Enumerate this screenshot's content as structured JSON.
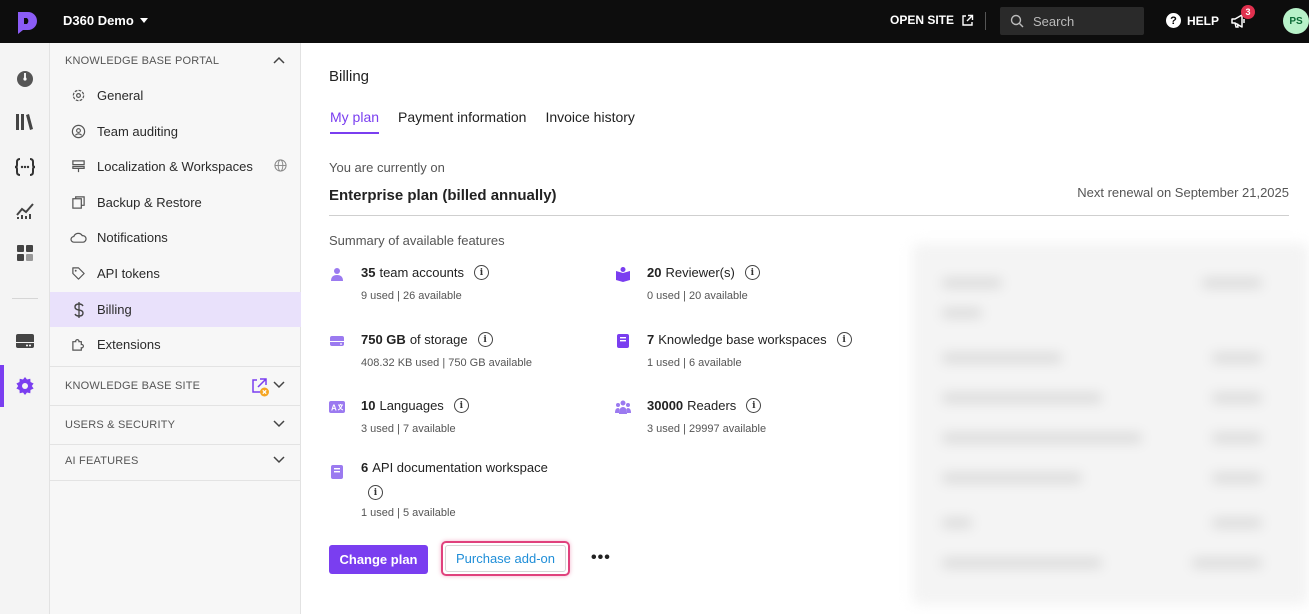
{
  "topbar": {
    "project_name": "D360 Demo",
    "open_site_label": "OPEN SITE",
    "search_placeholder": "Search",
    "help_label": "HELP",
    "notification_count": "3",
    "avatar_initials": "PS"
  },
  "sidenav": {
    "kb_portal": {
      "header": "KNOWLEDGE BASE PORTAL",
      "items": [
        {
          "label": "General",
          "icon": "gear-icon"
        },
        {
          "label": "Team auditing",
          "icon": "audit-icon"
        },
        {
          "label": "Localization & Workspaces",
          "icon": "workspaces-icon"
        },
        {
          "label": "Backup & Restore",
          "icon": "backup-icon"
        },
        {
          "label": "Notifications",
          "icon": "cloud-bell-icon"
        },
        {
          "label": "API tokens",
          "icon": "tag-icon"
        },
        {
          "label": "Billing",
          "icon": "dollar-icon"
        },
        {
          "label": "Extensions",
          "icon": "puzzle-icon"
        }
      ]
    },
    "kb_site_header": "KNOWLEDGE BASE SITE",
    "users_security_header": "USERS & SECURITY",
    "ai_features_header": "AI FEATURES"
  },
  "main": {
    "page_title": "Billing",
    "tabs": [
      {
        "label": "My plan",
        "active": true
      },
      {
        "label": "Payment information",
        "active": false
      },
      {
        "label": "Invoice history",
        "active": false
      }
    ],
    "current_on_label": "You are currently on",
    "plan_name": "Enterprise plan (billed annually)",
    "renewal_text": "Next renewal on September 21,2025",
    "summary_label": "Summary of available features",
    "features": [
      {
        "count": "35",
        "name": "team accounts",
        "usage": "9 used | 26 available",
        "icon": "user-icon"
      },
      {
        "count": "20",
        "name": "Reviewer(s)",
        "usage": "0 used | 20 available",
        "icon": "reviewer-icon"
      },
      {
        "count": "750 GB",
        "name": "of storage",
        "usage": "408.32 KB used | 750 GB available",
        "icon": "storage-icon"
      },
      {
        "count": "7",
        "name": "Knowledge base workspaces",
        "usage": "1 used | 6 available",
        "icon": "book-icon"
      },
      {
        "count": "10",
        "name": "Languages",
        "usage": "3 used | 7 available",
        "icon": "language-icon"
      },
      {
        "count": "30000",
        "name": "Readers",
        "usage": "3 used | 29997 available",
        "icon": "readers-icon"
      },
      {
        "count": "6",
        "name": "API documentation workspace",
        "usage": "1 used | 5 available",
        "icon": "api-book-icon"
      }
    ],
    "buttons": {
      "change_plan": "Change plan",
      "purchase_addon": "Purchase add-on",
      "more": "•••"
    }
  },
  "colors": {
    "accent": "#7a3ef0",
    "topbar_bg": "#0d0d0d",
    "highlight": "#e0427d",
    "link": "#1f8ed8"
  }
}
